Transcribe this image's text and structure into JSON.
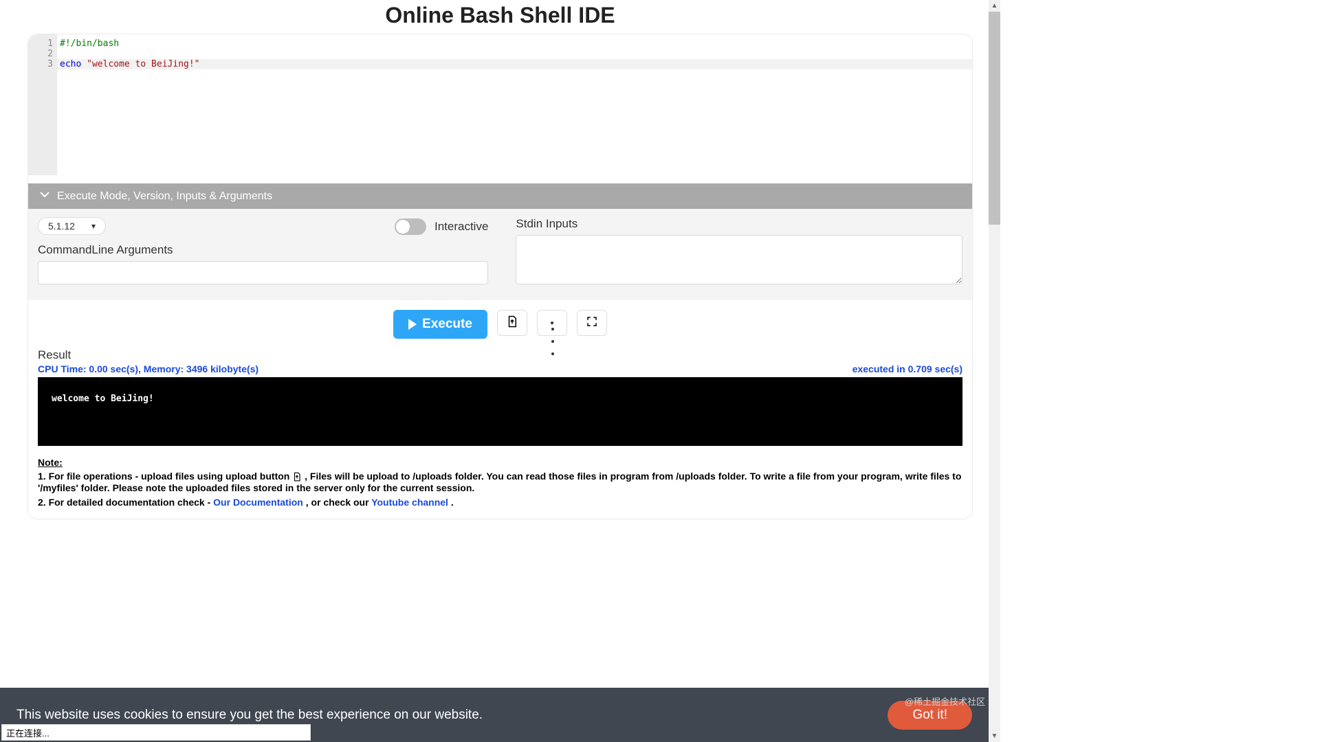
{
  "title": "Online Bash Shell IDE",
  "editor": {
    "lines": [
      "1",
      "2",
      "3"
    ],
    "code": {
      "l1_comment": "#!/bin/bash",
      "l3_kw": "echo ",
      "l3_str": "\"welcome to BeiJing!\"",
      "cursor_line": 3
    }
  },
  "collapse_header": "Execute Mode, Version, Inputs & Arguments",
  "version_select": {
    "selected": "5.1.12"
  },
  "interactive": {
    "label": "Interactive",
    "on": false
  },
  "cmdline": {
    "label": "CommandLine Arguments",
    "value": ""
  },
  "stdin": {
    "label": "Stdin Inputs",
    "value": ""
  },
  "buttons": {
    "execute": "Execute"
  },
  "result": {
    "label": "Result",
    "metrics_left": "CPU Time: 0.00 sec(s), Memory: 3496 kilobyte(s)",
    "metrics_right": "executed in 0.709 sec(s)",
    "output": "welcome to BeiJing!"
  },
  "notes": {
    "title": "Note:",
    "line1a": "1. For file operations - upload files using upload button ",
    "line1b": ", Files will be upload to /uploads folder. You can read those files in program from /uploads folder. To write a file from your program, write files to '/myfiles' folder. Please note the uploaded files stored in the server only for the current session.",
    "line2a": "2. For detailed documentation check - ",
    "link_doc": "Our Documentation",
    "line2b": ", or check our ",
    "link_yt": "Youtube channel",
    "period": "."
  },
  "cookie": {
    "text": "This website uses cookies to ensure you get the best experience on our website.",
    "button": "Got it!"
  },
  "watermark": "@稀土掘金技术社区",
  "status_popup": "正在连接..."
}
